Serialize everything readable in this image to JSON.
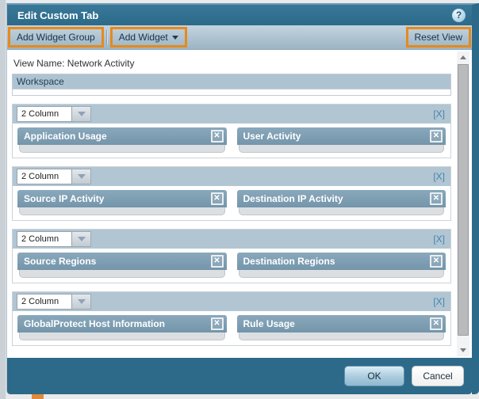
{
  "window": {
    "title": "Edit Custom Tab"
  },
  "icons": {
    "help": "?",
    "close_x": "✕"
  },
  "toolbar": {
    "add_widget_group_label": "Add Widget Group",
    "add_widget_label": "Add Widget",
    "reset_view_label": "Reset View"
  },
  "content": {
    "view_name_label": "View Name: Network Activity",
    "workspace_label": "Workspace"
  },
  "groups": [
    {
      "column_select_value": "2 Column",
      "remove_link": "[X]",
      "widgets": [
        {
          "title": "Application Usage"
        },
        {
          "title": "User Activity"
        }
      ]
    },
    {
      "column_select_value": "2 Column",
      "remove_link": "[X]",
      "widgets": [
        {
          "title": "Source IP Activity"
        },
        {
          "title": "Destination IP Activity"
        }
      ]
    },
    {
      "column_select_value": "2 Column",
      "remove_link": "[X]",
      "widgets": [
        {
          "title": "Source Regions"
        },
        {
          "title": "Destination Regions"
        }
      ]
    },
    {
      "column_select_value": "2 Column",
      "remove_link": "[X]",
      "widgets": [
        {
          "title": "GlobalProtect Host Information"
        },
        {
          "title": "Rule Usage"
        }
      ]
    }
  ],
  "footer": {
    "ok_label": "OK",
    "cancel_label": "Cancel"
  },
  "colors": {
    "titlebar": "#2d6a89",
    "toolbar": "#a9c0cf",
    "annotation_orange": "#e8891b",
    "group_header": "#b1c5d3",
    "widget_header": "#7d9cb1",
    "remove_link_blue": "#4585aa"
  }
}
